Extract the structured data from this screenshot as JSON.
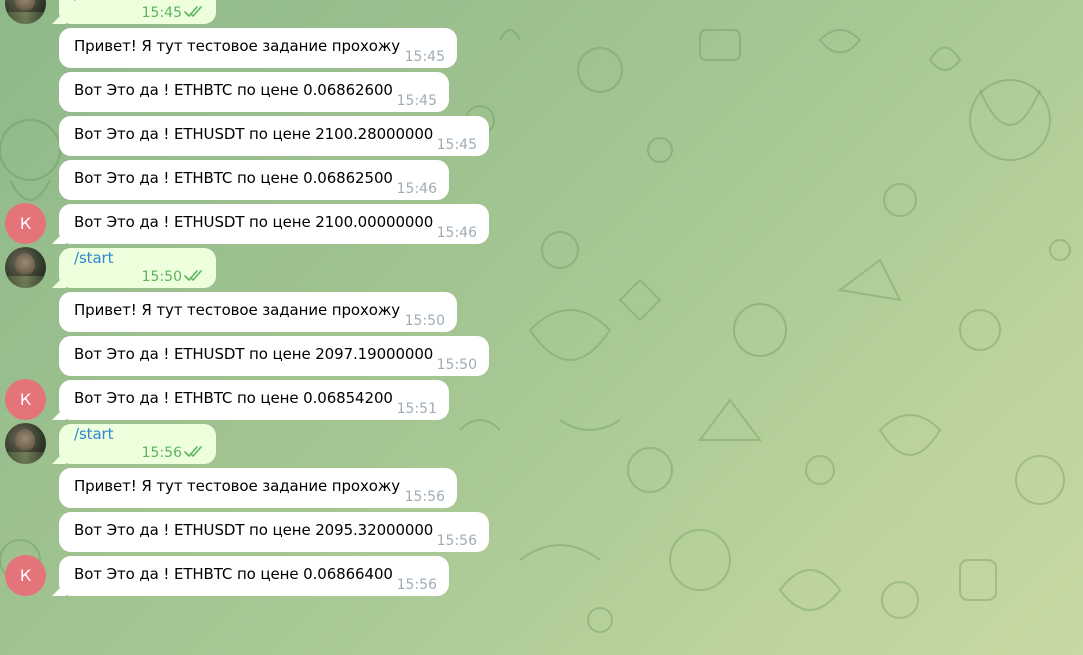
{
  "colors": {
    "incoming_bubble": "#ffffff",
    "outgoing_bubble": "#eeffde",
    "time_incoming": "#a0acb6",
    "time_outgoing": "#5cb45b",
    "link": "#2c8ad0",
    "avatar_letter_bg": "#e4737a"
  },
  "icons": {
    "read_receipt": "double-check-icon",
    "user_photo": "user-photo-avatar",
    "bot_avatar": "letter-avatar"
  },
  "bot_avatar_letter": "К",
  "messages": [
    {
      "direction": "out",
      "text": "/start",
      "time": "15:45"
    },
    {
      "direction": "in",
      "text": "Привет! Я тут тестовое задание прохожу",
      "time": "15:45"
    },
    {
      "direction": "in",
      "text": "Вот Это да ! ETHBTC по цене 0.06862600",
      "time": "15:45"
    },
    {
      "direction": "in",
      "text": "Вот Это да ! ETHUSDT по цене 2100.28000000",
      "time": "15:45"
    },
    {
      "direction": "in",
      "text": "Вот Это да ! ETHBTC по цене 0.06862500",
      "time": "15:46"
    },
    {
      "direction": "in",
      "text": "Вот Это да ! ETHUSDT по цене 2100.00000000",
      "time": "15:46"
    },
    {
      "direction": "out",
      "text": "/start",
      "time": "15:50"
    },
    {
      "direction": "in",
      "text": "Привет! Я тут тестовое задание прохожу",
      "time": "15:50"
    },
    {
      "direction": "in",
      "text": "Вот Это да ! ETHUSDT по цене 2097.19000000",
      "time": "15:50"
    },
    {
      "direction": "in",
      "text": "Вот Это да ! ETHBTC по цене 0.06854200",
      "time": "15:51"
    },
    {
      "direction": "out",
      "text": "/start",
      "time": "15:56"
    },
    {
      "direction": "in",
      "text": "Привет! Я тут тестовое задание прохожу",
      "time": "15:56"
    },
    {
      "direction": "in",
      "text": "Вот Это да ! ETHUSDT по цене 2095.32000000",
      "time": "15:56"
    },
    {
      "direction": "in",
      "text": "Вот Это да ! ETHBTC по цене 0.06866400",
      "time": "15:56"
    }
  ]
}
